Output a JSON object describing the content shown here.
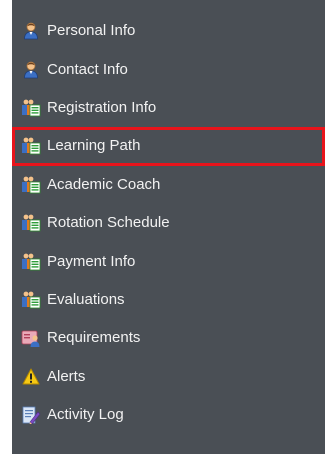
{
  "menu": {
    "items": [
      {
        "label": "Personal Info",
        "icon": "person-icon"
      },
      {
        "label": "Contact Info",
        "icon": "person-icon"
      },
      {
        "label": "Registration Info",
        "icon": "people-document-icon"
      },
      {
        "label": "Learning Path",
        "icon": "people-document-icon",
        "highlighted": true
      },
      {
        "label": "Academic Coach",
        "icon": "people-document-icon"
      },
      {
        "label": "Rotation Schedule",
        "icon": "people-document-icon"
      },
      {
        "label": "Payment Info",
        "icon": "people-document-icon"
      },
      {
        "label": "Evaluations",
        "icon": "people-document-icon"
      },
      {
        "label": "Requirements",
        "icon": "requirements-card-icon"
      },
      {
        "label": "Alerts",
        "icon": "warning-icon"
      },
      {
        "label": "Activity Log",
        "icon": "activity-log-icon"
      }
    ]
  },
  "colors": {
    "sidebar_bg": "#4a4f55",
    "label_text": "#f2f2f2",
    "highlight_border": "#e8141b"
  }
}
